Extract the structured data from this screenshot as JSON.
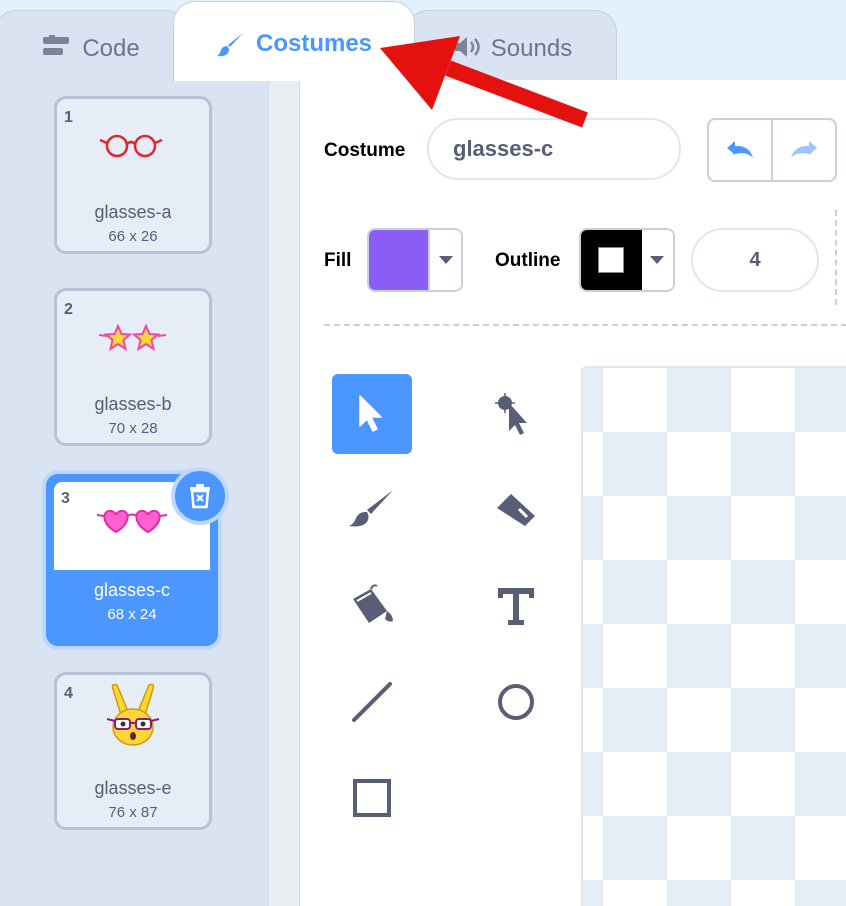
{
  "tabs": {
    "code": "Code",
    "costumes": "Costumes",
    "sounds": "Sounds"
  },
  "costumes": [
    {
      "num": "1",
      "name": "glasses-a",
      "size": "66 x 26"
    },
    {
      "num": "2",
      "name": "glasses-b",
      "size": "70 x 28"
    },
    {
      "num": "3",
      "name": "glasses-c",
      "size": "68 x 24"
    },
    {
      "num": "4",
      "name": "glasses-e",
      "size": "76 x 87"
    }
  ],
  "editor": {
    "costume_label": "Costume",
    "costume_name": "glasses-c",
    "fill_label": "Fill",
    "outline_label": "Outline",
    "outline_width": "4",
    "fill_color": "#8c5cf6",
    "outline_color": "#000000"
  },
  "icons": {
    "code_tab": "code-blocks-icon",
    "costumes_tab": "paintbrush-icon",
    "sounds_tab": "speaker-icon",
    "delete": "trash-icon",
    "undo": "undo-icon",
    "redo": "redo-icon",
    "tools": [
      "select-icon",
      "reshape-icon",
      "brush-icon",
      "eraser-icon",
      "fill-bucket-icon",
      "text-icon",
      "line-icon",
      "circle-icon",
      "rectangle-icon"
    ]
  },
  "colors": {
    "accent": "#4c97ff",
    "annotation_arrow": "#e5110f"
  }
}
